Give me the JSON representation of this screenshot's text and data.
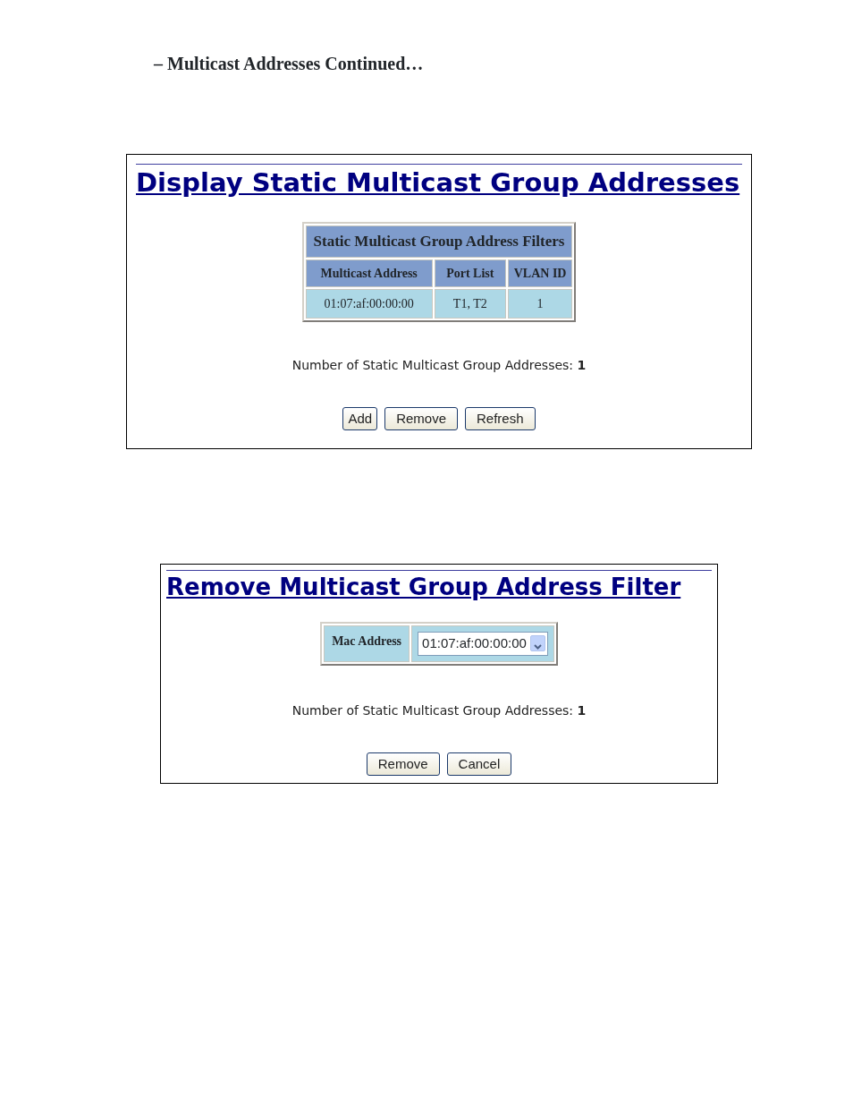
{
  "page_heading": "– Multicast Addresses Continued…",
  "display_panel": {
    "title": "Display Static Multicast Group Addresses",
    "table": {
      "caption": "Static Multicast Group Address Filters",
      "columns": [
        "Multicast Address",
        "Port List",
        "VLAN ID"
      ],
      "rows": [
        [
          "01:07:af:00:00:00",
          "T1, T2",
          "1"
        ]
      ]
    },
    "count_text": "Number of Static Multicast Group Addresses: **1**",
    "buttons": [
      "Add",
      "Remove",
      "Refresh"
    ]
  },
  "remove_panel": {
    "title": "Remove Multicast Group Address Filter",
    "field_label": "Mac Address",
    "field_value": "01:07:af:00:00:00",
    "count_text": "Number of Static Multicast Group Addresses: **1**",
    "buttons": [
      "Remove",
      "Cancel"
    ]
  }
}
